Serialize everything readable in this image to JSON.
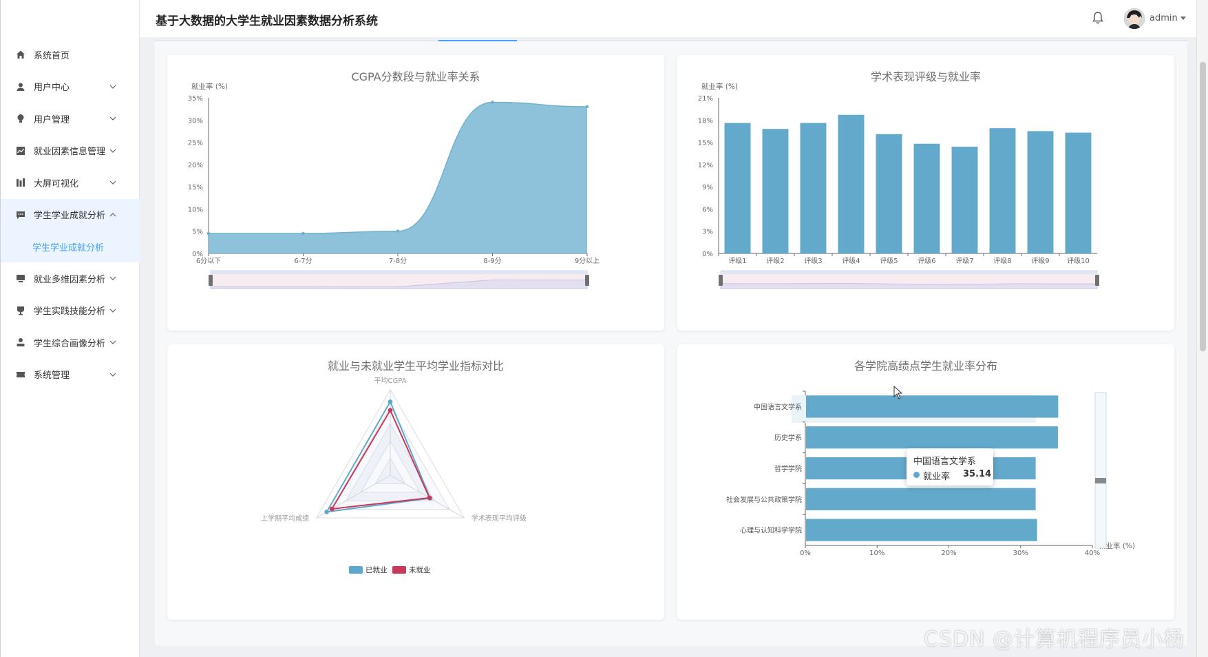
{
  "app": {
    "title": "基于大数据的大学生就业因素数据分析系统",
    "user": "admin"
  },
  "sidebar": {
    "items": [
      {
        "label": "系统首页",
        "icon": "home-icon",
        "has_children": false
      },
      {
        "label": "用户中心",
        "icon": "user-icon",
        "has_children": true
      },
      {
        "label": "用户管理",
        "icon": "bulb-icon",
        "has_children": true
      },
      {
        "label": "就业因素信息管理",
        "icon": "line-chart-icon",
        "has_children": true
      },
      {
        "label": "大屏可视化",
        "icon": "bar-chart-icon",
        "has_children": true
      },
      {
        "label": "学生学业成就分析",
        "icon": "message-icon",
        "has_children": true,
        "open": true
      },
      {
        "label": "就业多维因素分析",
        "icon": "monitor-icon",
        "has_children": true
      },
      {
        "label": "学生实践技能分析",
        "icon": "cup-icon",
        "has_children": true
      },
      {
        "label": "学生综合画像分析",
        "icon": "person-icon",
        "has_children": true
      },
      {
        "label": "系统管理",
        "icon": "ticket-icon",
        "has_children": true
      }
    ],
    "active_subitem": "学生学业成就分析"
  },
  "charts": {
    "area_title": "CGPA分数段与就业率关系",
    "bar_title": "学术表现评级与就业率",
    "radar_title": "就业与未就业学生平均学业指标对比",
    "hbar_title": "各学院高绩点学生就业率分布"
  },
  "tooltip": {
    "title": "中国语言文学系",
    "label": "就业率",
    "value": "35.14"
  },
  "watermark": "CSDN @计算机程序员小杨",
  "colors": {
    "primary": "#409eff",
    "chart_blue": "#5ea8cd",
    "chart_red": "#c9395a"
  },
  "chart_data": [
    {
      "type": "area",
      "title": "CGPA分数段与就业率关系",
      "ylabel": "就业率 (%)",
      "categories": [
        "6分以下",
        "6-7分",
        "7-8分",
        "8-9分",
        "9分以上"
      ],
      "values": [
        4.5,
        4.5,
        5.0,
        34.0,
        33.0
      ],
      "ylim": [
        0,
        35
      ],
      "yticks": [
        "0%",
        "5%",
        "10%",
        "15%",
        "20%",
        "25%",
        "30%",
        "35%"
      ]
    },
    {
      "type": "bar",
      "title": "学术表现评级与就业率",
      "ylabel": "就业率 (%)",
      "categories": [
        "评级1",
        "评级2",
        "评级3",
        "评级4",
        "评级5",
        "评级6",
        "评级7",
        "评级8",
        "评级9",
        "评级10"
      ],
      "values": [
        17.6,
        16.8,
        17.6,
        18.7,
        16.1,
        14.8,
        14.4,
        16.9,
        16.5,
        16.3
      ],
      "ylim": [
        0,
        21
      ],
      "yticks": [
        "0%",
        "3%",
        "6%",
        "9%",
        "12%",
        "15%",
        "18%",
        "21%"
      ]
    },
    {
      "type": "radar",
      "title": "就业与未就业学生平均学业指标对比",
      "indicators": [
        "平均CGPA",
        "学术表现平均评级",
        "上学期平均成绩"
      ],
      "series": [
        {
          "name": "已就业",
          "values": [
            0.86,
            0.54,
            0.86
          ]
        },
        {
          "name": "未就业",
          "values": [
            0.76,
            0.53,
            0.79
          ]
        }
      ]
    },
    {
      "type": "bar",
      "orientation": "horizontal",
      "title": "各学院高绩点学生就业率分布",
      "xlabel": "就业率 (%)",
      "categories": [
        "中国语言文学系",
        "历史学系",
        "哲学学院",
        "社会发展与公共政策学院",
        "心理与认知科学学院"
      ],
      "values": [
        35.14,
        35.1,
        32.0,
        32.0,
        32.2
      ],
      "xlim": [
        0,
        40
      ],
      "xticks": [
        "0%",
        "10%",
        "20%",
        "30%",
        "40%"
      ]
    }
  ]
}
